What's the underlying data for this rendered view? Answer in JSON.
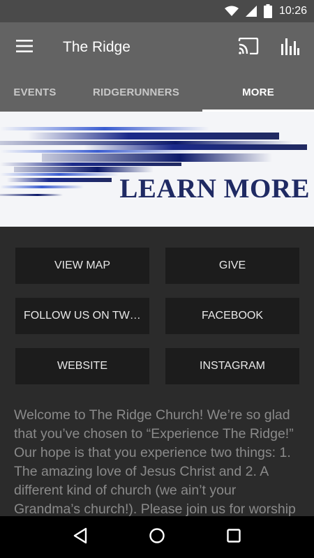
{
  "status_bar": {
    "time": "10:26",
    "icons": [
      "wifi-icon",
      "signal-icon",
      "battery-icon"
    ]
  },
  "app_bar": {
    "title": "The Ridge",
    "actions": [
      "cast-icon",
      "bar-chart-icon"
    ]
  },
  "tabs": [
    {
      "label": "EVENTS",
      "selected": false
    },
    {
      "label": "RIDGERUNNERS",
      "selected": false
    },
    {
      "label": "MORE",
      "selected": true
    }
  ],
  "banner": {
    "text": "LEARN MORE"
  },
  "buttons": [
    {
      "label": "VIEW MAP"
    },
    {
      "label": "GIVE"
    },
    {
      "label": "FOLLOW US ON TWI…"
    },
    {
      "label": "FACEBOOK"
    },
    {
      "label": "WEBSITE"
    },
    {
      "label": "INSTAGRAM"
    }
  ],
  "welcome_text": "Welcome to The Ridge Church!  We’re so glad that you’ve chosen to “Experience The Ridge!” Our hope is that you experience two things: 1. The amazing love of Jesus Christ and 2. A different kind of church (we ain’t your Grandma’s church!).  Please join us for worship",
  "nav_bar": {
    "buttons": [
      "back-icon",
      "home-icon",
      "recents-icon"
    ]
  },
  "colors": {
    "app_bar": "#636363",
    "status_bar": "#4a4a4a",
    "content_bg": "#2b2b2b",
    "button_bg": "#1c1c1c",
    "banner_text": "#1f2a63"
  }
}
